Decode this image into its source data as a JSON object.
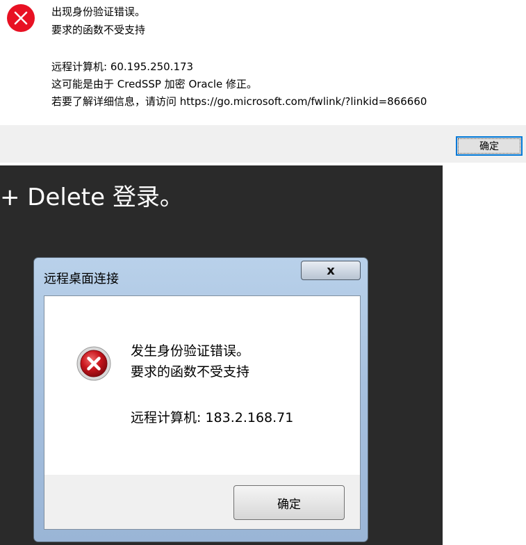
{
  "top_dialog": {
    "error_line1": "出现身份验证错误。",
    "error_line2": "要求的函数不受支持",
    "remote_computer": "远程计算机: 60.195.250.173",
    "cause": "这可能是由于 CredSSP 加密 Oracle 修正。",
    "more_info": "若要了解详细信息，请访问 https://go.microsoft.com/fwlink/?linkid=866660",
    "ok_label": "确定",
    "icon": "error-x-icon",
    "accent": "#0078d7",
    "error_color": "#e81123"
  },
  "bottom_screen": {
    "background_text": "+ Delete 登录。",
    "dialog": {
      "title": "远程桌面连接",
      "close_label": "x",
      "error_line1": "发生身份验证错误。",
      "error_line2": "要求的函数不受支持",
      "remote_computer": "远程计算机: 183.2.168.71",
      "ok_label": "确定",
      "icon": "error-x-icon"
    }
  }
}
